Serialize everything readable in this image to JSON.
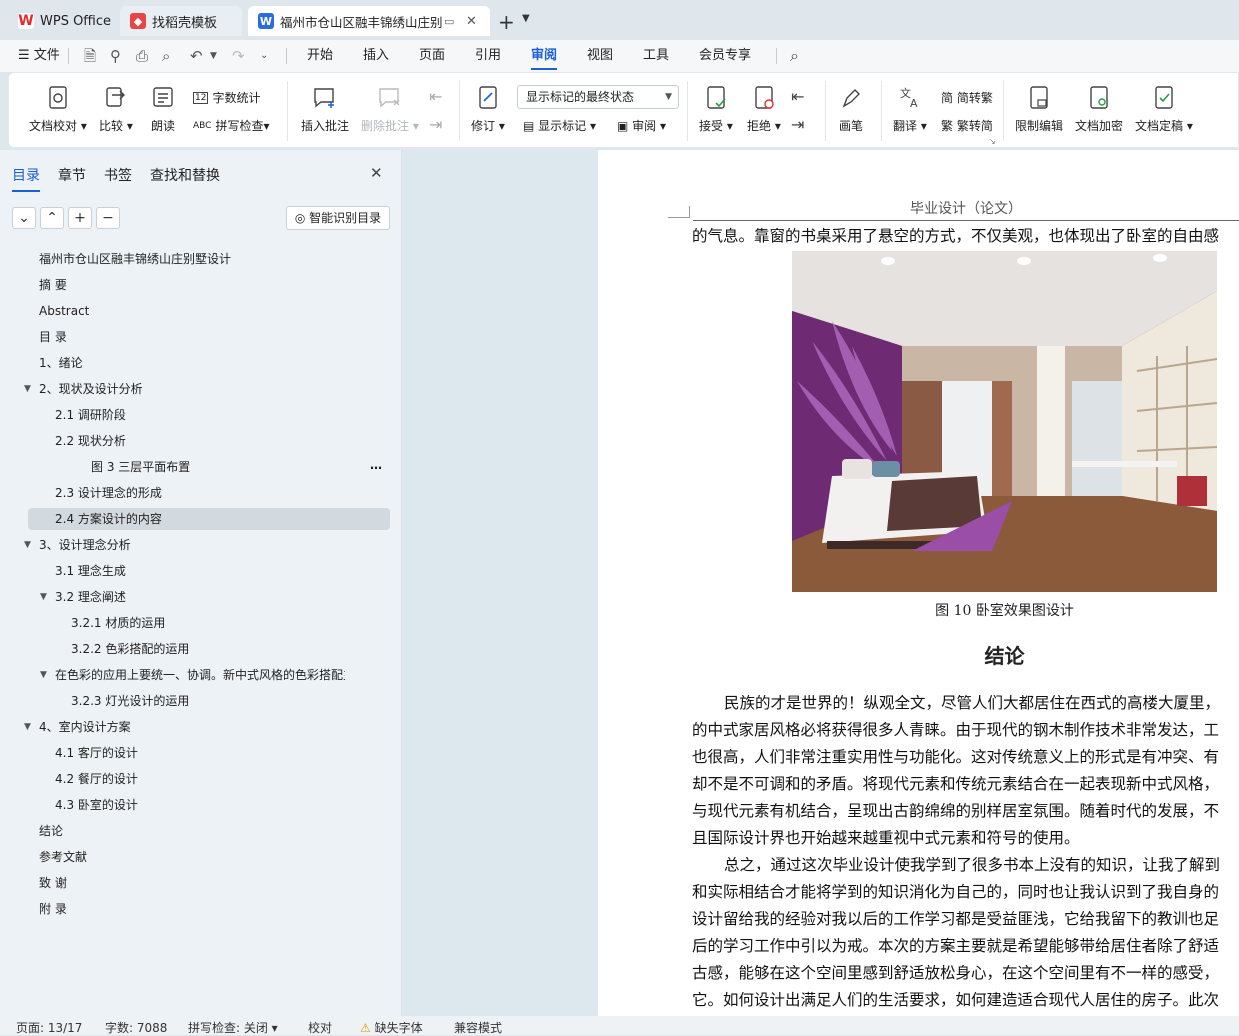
{
  "tabs": [
    {
      "label": "WPS Office",
      "icon": "wps-logo"
    },
    {
      "label": "找稻壳模板",
      "icon": "docer-logo"
    },
    {
      "label": "福州市仓山区融丰锦绣山庄别墅",
      "icon": "word-doc-icon"
    }
  ],
  "menu": {
    "file": "文件",
    "items": [
      "开始",
      "插入",
      "页面",
      "引用",
      "审阅",
      "视图",
      "工具",
      "会员专享"
    ],
    "active": "审阅"
  },
  "ribbon": {
    "doc_check": "文档校对",
    "compare": "比较",
    "read_aloud": "朗读",
    "word_count": "字数统计",
    "spell_check": "拼写检查",
    "insert_comment": "插入批注",
    "delete_comment": "删除批注",
    "track": "修订",
    "markup_state": "显示标记的最终状态",
    "show_markup": "显示标记",
    "review": "审阅",
    "accept": "接受",
    "reject": "拒绝",
    "pen": "画笔",
    "translate": "翻译",
    "to_trad": "简转繁",
    "to_simp": "繁转简",
    "restrict_edit": "限制编辑",
    "encrypt": "文档加密",
    "finalize": "文档定稿"
  },
  "panel": {
    "tabs": [
      "目录",
      "章节",
      "书签",
      "查找和替换"
    ],
    "smart_toc": "智能识别目录",
    "toc": [
      {
        "label": "福州市仓山区融丰锦绣山庄别墅设计",
        "level": 0
      },
      {
        "label": "摘    要",
        "level": 0
      },
      {
        "label": "Abstract",
        "level": 0
      },
      {
        "label": "目  录",
        "level": 0
      },
      {
        "label": "1、绪论",
        "level": 0
      },
      {
        "label": "2、现状及设计分析",
        "level": 0,
        "expanded": true
      },
      {
        "label": "2.1 调研阶段",
        "level": 1
      },
      {
        "label": "2.2 现状分析",
        "level": 1
      },
      {
        "label": "图 3 三层平面布置",
        "level": 3,
        "more": "…"
      },
      {
        "label": "2.3 设计理念的形成",
        "level": 1
      },
      {
        "label": "2.4 方案设计的内容",
        "level": 1,
        "selected": true
      },
      {
        "label": "3、设计理念分析",
        "level": 0,
        "expanded": true
      },
      {
        "label": "3.1 理念生成",
        "level": 1
      },
      {
        "label": "3.2 理念阐述",
        "level": 1,
        "expanded": true
      },
      {
        "label": "3.2.1 材质的运用",
        "level": 2
      },
      {
        "label": "3.2.2 色彩搭配的运用",
        "level": 2
      },
      {
        "label": "在色彩的应用上要统一、协调。新中式风格的色彩搭配主要…",
        "level": 1,
        "expanded": true
      },
      {
        "label": "3.2.3 灯光设计的运用",
        "level": 2
      },
      {
        "label": "4、室内设计方案",
        "level": 0,
        "expanded": true
      },
      {
        "label": "4.1 客厅的设计",
        "level": 1
      },
      {
        "label": "4.2 餐厅的设计",
        "level": 1
      },
      {
        "label": "4.3 卧室的设计",
        "level": 1
      },
      {
        "label": "结论",
        "level": 0
      },
      {
        "label": "参考文献",
        "level": 0
      },
      {
        "label": "致  谢",
        "level": 0
      },
      {
        "label": "附  录",
        "level": 0
      }
    ]
  },
  "doc": {
    "header": "毕业设计（论文）",
    "line_top": "的气息。靠窗的书桌采用了悬空的方式，不仅美观，也体现出了卧室的自由感",
    "caption": "图 10 卧室效果图设计",
    "heading": "结论",
    "paragraphs": [
      "民族的才是世界的！纵观全文，尽管人们大都居住在西式的高楼大厦里，",
      "的中式家居风格必将获得很多人青睐。由于现代的钢木制作技术非常发达，工",
      "也很高，人们非常注重实用性与功能化。这对传统意义上的形式是有冲突、有",
      "却不是不可调和的矛盾。将现代元素和传统元素结合在一起表现新中式风格，",
      "与现代元素有机结合，呈现出古韵绵绵的别样居室氛围。随着时代的发展，不",
      "且国际设计界也开始越来越重视中式元素和符号的使用。",
      "总之，通过这次毕业设计使我学到了很多书本上没有的知识，让我了解到",
      "和实际相结合才能将学到的知识消化为自己的，同时也让我认识到了我自身的",
      "设计留给我的经验对我以后的工作学习都是受益匪浅，它给我留下的教训也足",
      "后的学习工作中引以为戒。本次的方案主要就是希望能够带给居住者除了舒适",
      "古感，能够在这个空间里感到舒适放松身心，在这个空间里有不一样的感受，",
      "它。如何设计出满足人们的生活要求，如何建造适合现代人居住的房子。此次"
    ]
  },
  "status": {
    "page": "页面: 13/17",
    "words": "字数: 7088",
    "spell": "拼写检查: 关闭",
    "proof": "校对",
    "missing_font": "缺失字体",
    "compat": "兼容模式"
  }
}
